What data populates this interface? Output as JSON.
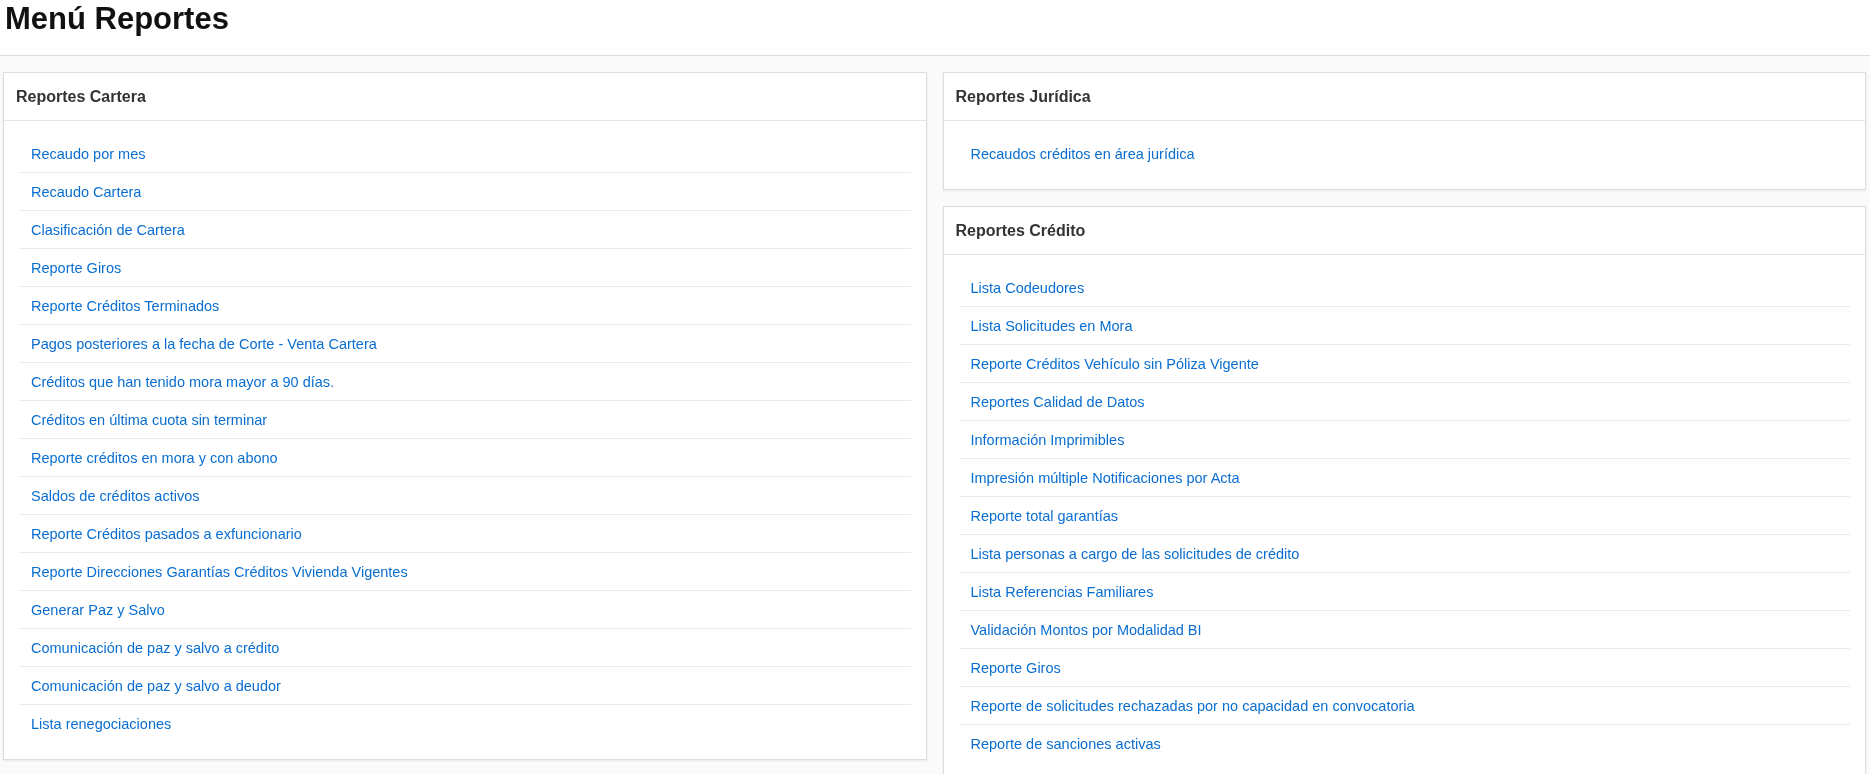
{
  "page_title": "Menú Reportes",
  "columns": [
    [
      {
        "title": "Reportes Cartera",
        "links": [
          "Recaudo por mes",
          "Recaudo Cartera",
          "Clasificación de Cartera",
          "Reporte Giros",
          "Reporte Créditos Terminados",
          "Pagos posteriores a la fecha de Corte - Venta Cartera",
          "Créditos que han tenido mora mayor a 90 días.",
          "Créditos en última cuota sin terminar",
          "Reporte créditos en mora y con abono",
          "Saldos de créditos activos",
          "Reporte Créditos pasados a exfuncionario",
          "Reporte Direcciones Garantías Créditos Vivienda Vigentes",
          "Generar Paz y Salvo",
          "Comunicación de paz y salvo a crédito",
          "Comunicación de paz y salvo a deudor",
          "Lista renegociaciones"
        ]
      }
    ],
    [
      {
        "title": "Reportes Jurídica",
        "links": [
          "Recaudos créditos en área jurídica"
        ]
      },
      {
        "title": "Reportes Crédito",
        "links": [
          "Lista Codeudores",
          "Lista Solicitudes en Mora",
          "Reporte Créditos Vehículo sin Póliza Vigente",
          "Reportes Calidad de Datos",
          "Información Imprimibles",
          "Impresión múltiple Notificaciones por Acta",
          "Reporte total garantías",
          "Lista personas a cargo de las solicitudes de crédito",
          "Lista Referencias Familiares",
          "Validación Montos por Modalidad BI",
          "Reporte Giros",
          "Reporte de solicitudes rechazadas por no capacidad en convocatoria",
          "Reporte de sanciones activas"
        ]
      }
    ]
  ]
}
